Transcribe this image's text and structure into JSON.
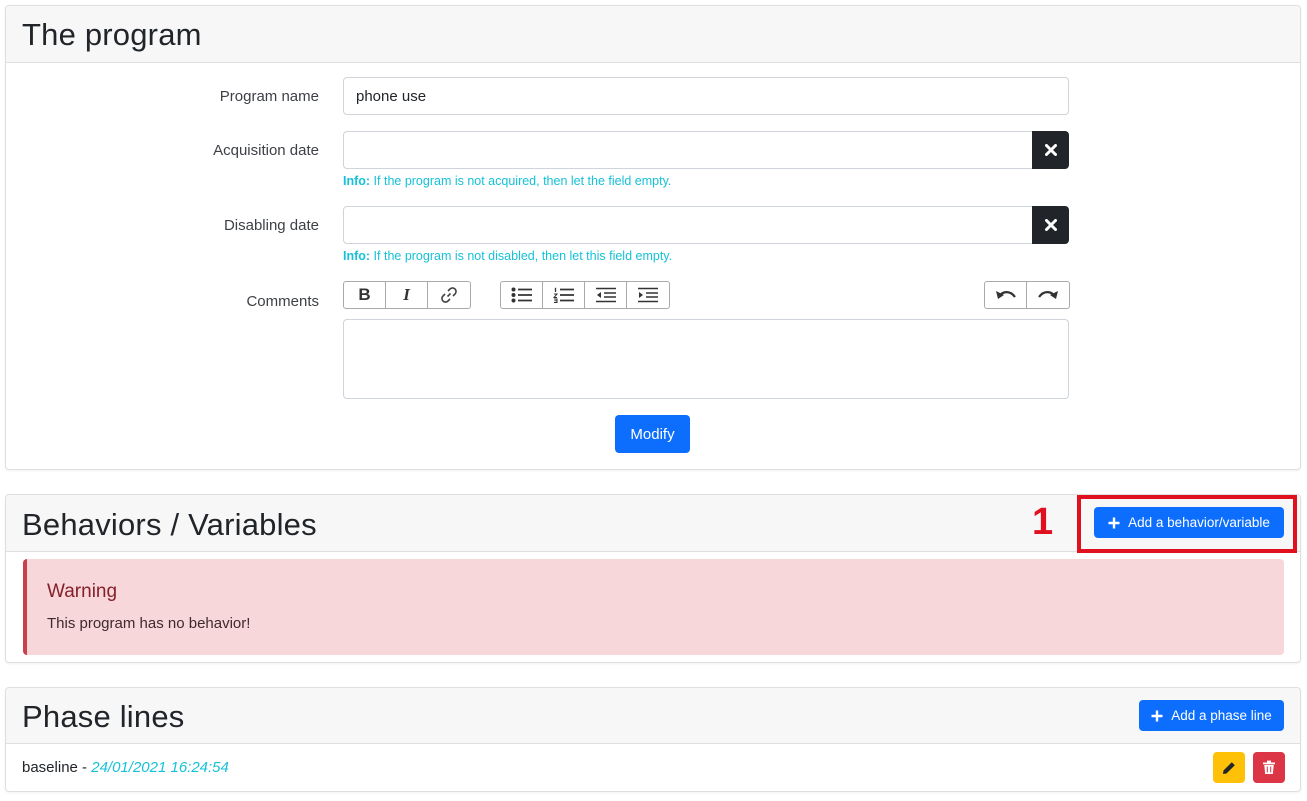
{
  "program_card": {
    "title": "The program",
    "fields": {
      "program_name_label": "Program name",
      "program_name_value": "phone use",
      "acquisition_date_label": "Acquisition date",
      "acquisition_date_value": "",
      "acquisition_info_prefix": "Info:",
      "acquisition_info_text": " If the program is not acquired, then let the field empty.",
      "disabling_date_label": "Disabling date",
      "disabling_date_value": "",
      "disabling_info_prefix": "Info:",
      "disabling_info_text": " If the program is not disabled, then let this field empty.",
      "comments_label": "Comments",
      "comments_value": ""
    },
    "toolbar": {
      "bold": "B",
      "italic": "I",
      "clear_icon": "close-icon"
    },
    "modify_label": "Modify"
  },
  "behaviors_card": {
    "title": "Behaviors / Variables",
    "annotation_number": "1",
    "add_button_label": "Add a behavior/variable",
    "warning": {
      "title": "Warning",
      "message": "This program has no behavior!"
    }
  },
  "phases_card": {
    "title": "Phase lines",
    "add_button_label": "Add a phase line",
    "rows": [
      {
        "name": "baseline",
        "separator": " - ",
        "date": "24/01/2021 16:24:54"
      }
    ]
  },
  "colors": {
    "primary": "#0d6efd",
    "info": "#17c1d8",
    "warning_bg": "#f8d7da",
    "annotation_red": "#e0101f",
    "edit_yellow": "#ffc107",
    "delete_red": "#dc3545"
  }
}
